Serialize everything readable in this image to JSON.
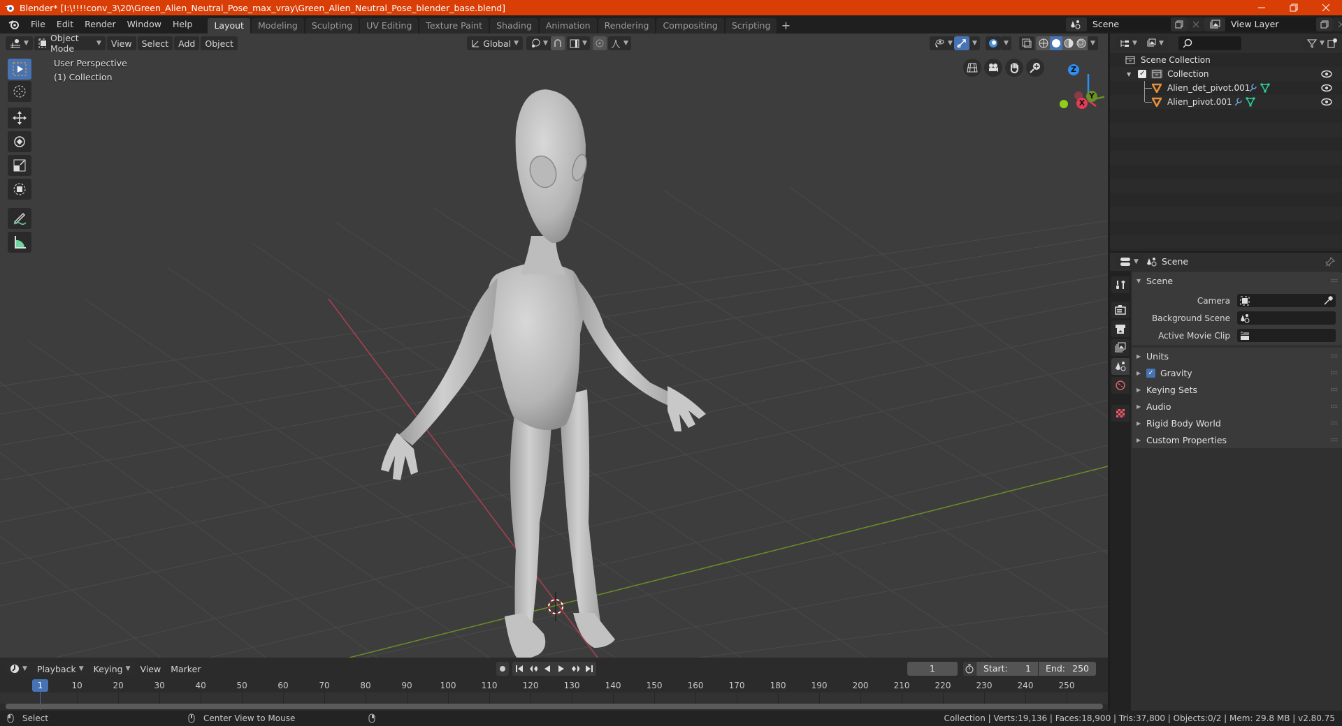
{
  "window": {
    "title": "Blender* [I:\\!!!!conv_3\\20\\Green_Alien_Neutral_Pose_max_vray\\Green_Alien_Neutral_Pose_blender_base.blend]",
    "accent": "#d93e07"
  },
  "menu": [
    "File",
    "Edit",
    "Render",
    "Window",
    "Help"
  ],
  "workspaces": [
    {
      "label": "Layout",
      "active": true
    },
    {
      "label": "Modeling"
    },
    {
      "label": "Sculpting"
    },
    {
      "label": "UV Editing"
    },
    {
      "label": "Texture Paint"
    },
    {
      "label": "Shading"
    },
    {
      "label": "Animation"
    },
    {
      "label": "Rendering"
    },
    {
      "label": "Compositing"
    },
    {
      "label": "Scripting"
    }
  ],
  "scene_selector": {
    "value": "Scene"
  },
  "view_layer_selector": {
    "value": "View Layer"
  },
  "viewport": {
    "mode": "Object Mode",
    "menus": [
      "View",
      "Select",
      "Add",
      "Object"
    ],
    "transform_orientation": "Global",
    "overlay_line1": "User Perspective",
    "overlay_line2": "(1) Collection",
    "gizmo_axes": {
      "x": "X",
      "y": "Y",
      "z": "Z"
    }
  },
  "outliner": {
    "root": "Scene Collection",
    "collection": "Collection",
    "objects": [
      {
        "name": "Alien_det_pivot.001"
      },
      {
        "name": "Alien_pivot.001"
      }
    ]
  },
  "properties": {
    "context": "Scene",
    "panel_title": "Scene",
    "fields": [
      {
        "label": "Camera",
        "value": ""
      },
      {
        "label": "Background Scene",
        "value": ""
      },
      {
        "label": "Active Movie Clip",
        "value": ""
      }
    ],
    "sections": [
      {
        "label": "Units"
      },
      {
        "label": "Gravity",
        "checkbox": true
      },
      {
        "label": "Keying Sets"
      },
      {
        "label": "Audio"
      },
      {
        "label": "Rigid Body World"
      },
      {
        "label": "Custom Properties"
      }
    ]
  },
  "timeline": {
    "menus": [
      "Playback",
      "Keying",
      "View",
      "Marker"
    ],
    "current_frame": "1",
    "start_label": "Start:",
    "start": "1",
    "end_label": "End:",
    "end": "250",
    "ticks": [
      "10",
      "20",
      "30",
      "40",
      "50",
      "60",
      "70",
      "80",
      "90",
      "100",
      "110",
      "120",
      "130",
      "140",
      "150",
      "160",
      "170",
      "180",
      "190",
      "200",
      "210",
      "220",
      "230",
      "240",
      "250"
    ],
    "playhead": "1"
  },
  "statusbar": {
    "left_action": "Select",
    "middle_action": "Center View to Mouse",
    "stats": "Collection | Verts:19,136 | Faces:18,900 | Tris:37,800 | Objects:0/2 | Mem: 29.8 MB | v2.80.75"
  }
}
